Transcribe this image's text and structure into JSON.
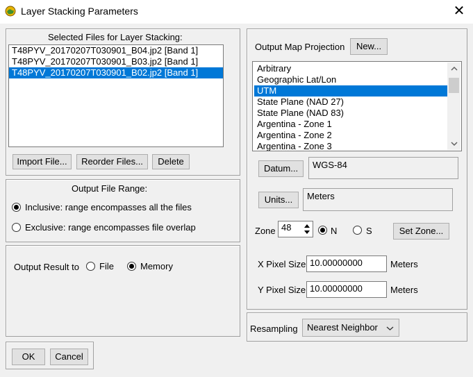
{
  "window": {
    "title": "Layer Stacking Parameters",
    "close_glyph": "✕",
    "app_icon": "globe-icon"
  },
  "files": {
    "label": "Selected Files for Layer Stacking:",
    "items": [
      "T48PYV_20170207T030901_B04.jp2 [Band 1]",
      "T48PYV_20170207T030901_B03.jp2 [Band 1]",
      "T48PYV_20170207T030901_B02.jp2 [Band 1]"
    ],
    "selected_index": 2,
    "import_label": "Import File...",
    "reorder_label": "Reorder Files...",
    "delete_label": "Delete"
  },
  "range": {
    "label": "Output File Range:",
    "inclusive_label": "Inclusive: range encompasses all the files",
    "exclusive_label": "Exclusive: range encompasses file overlap",
    "selected": "inclusive"
  },
  "output": {
    "label": "Output Result to",
    "file_label": "File",
    "memory_label": "Memory",
    "selected": "memory"
  },
  "projection": {
    "label": "Output Map Projection",
    "new_label": "New...",
    "items": [
      "Arbitrary",
      "Geographic Lat/Lon",
      "UTM",
      "State Plane (NAD 27)",
      "State Plane (NAD 83)",
      "Argentina - Zone 1",
      "Argentina - Zone 2",
      "Argentina - Zone 3"
    ],
    "selected_index": 2,
    "datum_label": "Datum...",
    "datum_value": "WGS-84",
    "units_label": "Units...",
    "units_value": "Meters",
    "zone_label": "Zone",
    "zone_value": "48",
    "n_label": "N",
    "s_label": "S",
    "hemisphere": "N",
    "set_zone_label": "Set Zone...",
    "x_pixel_label": "X Pixel Size",
    "x_pixel_value": "10.00000000",
    "y_pixel_label": "Y Pixel Size",
    "y_pixel_value": "10.00000000",
    "pixel_units": "Meters"
  },
  "resampling": {
    "label": "Resampling",
    "value": "Nearest Neighbor"
  },
  "footer": {
    "ok_label": "OK",
    "cancel_label": "Cancel"
  }
}
